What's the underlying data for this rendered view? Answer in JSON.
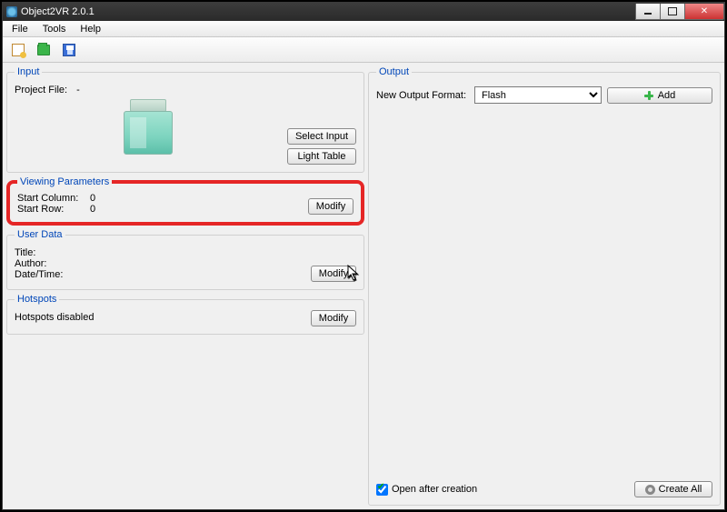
{
  "window": {
    "title": "Object2VR 2.0.1"
  },
  "menu": {
    "file": "File",
    "tools": "Tools",
    "help": "Help"
  },
  "input": {
    "legend": "Input",
    "project_file_label": "Project File:",
    "project_file_value": "-",
    "select_input_btn": "Select Input",
    "light_table_btn": "Light Table"
  },
  "viewing": {
    "legend": "Viewing Parameters",
    "start_column_label": "Start Column:",
    "start_column_value": "0",
    "start_row_label": "Start Row:",
    "start_row_value": "0",
    "modify_btn": "Modify"
  },
  "userdata": {
    "legend": "User Data",
    "title_label": "Title:",
    "author_label": "Author:",
    "datetime_label": "Date/Time:",
    "modify_btn": "Modify"
  },
  "hotspots": {
    "legend": "Hotspots",
    "disabled_text": "Hotspots disabled",
    "modify_btn": "Modify"
  },
  "output": {
    "legend": "Output",
    "new_format_label": "New Output Format:",
    "format_selected": "Flash",
    "add_btn": "Add",
    "open_after_label": "Open after creation",
    "create_all_btn": "Create All"
  }
}
